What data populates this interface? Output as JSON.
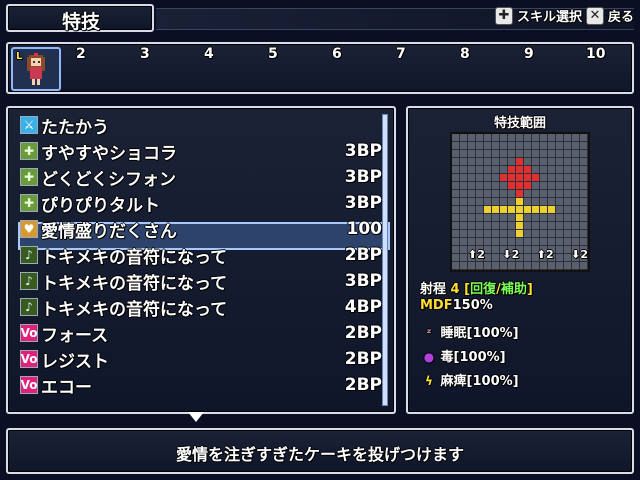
{
  "header": {
    "title": "特技",
    "hints": [
      {
        "icon": "✚",
        "label": "スキル選択"
      },
      {
        "icon": "✕",
        "label": "戻る"
      }
    ]
  },
  "party": {
    "slot1_label": "L",
    "slots": [
      "2",
      "3",
      "4",
      "5",
      "6",
      "7",
      "8",
      "9",
      "10"
    ]
  },
  "skills": [
    {
      "icon": "attack",
      "name": "たたかう",
      "cost": ""
    },
    {
      "icon": "plus",
      "name": "すやすやショコラ",
      "cost": "3BP"
    },
    {
      "icon": "plus",
      "name": "どくどくシフォン",
      "cost": "3BP"
    },
    {
      "icon": "plus",
      "name": "ぴりぴりタルト",
      "cost": "3BP"
    },
    {
      "icon": "heart",
      "name": "愛情盛りだくさん",
      "cost": "100"
    },
    {
      "icon": "note",
      "name": "トキメキの音符になって",
      "cost": "2BP"
    },
    {
      "icon": "note",
      "name": "トキメキの音符になって",
      "cost": "3BP"
    },
    {
      "icon": "note",
      "name": "トキメキの音符になって",
      "cost": "4BP"
    },
    {
      "icon": "vo",
      "name": "フォース",
      "cost": "2BP"
    },
    {
      "icon": "vo",
      "name": "レジスト",
      "cost": "2BP"
    },
    {
      "icon": "vo",
      "name": "エコー",
      "cost": "2BP"
    }
  ],
  "selected_index": 4,
  "range_panel": {
    "title": "特技範囲",
    "buffs": [
      "2",
      "2",
      "2",
      "2"
    ],
    "range_label": "射程",
    "range_value": "4",
    "range_type_open": "[",
    "range_type_a": "回復",
    "range_type_sep": "/",
    "range_type_b": "補助",
    "range_type_close": "]",
    "mdf_label": "MDF",
    "mdf_value": "150%",
    "effects": [
      {
        "icon": "sleep-icon",
        "label": "睡眠[100%]"
      },
      {
        "icon": "poison-icon",
        "label": "毒[100%]"
      },
      {
        "icon": "paralysis-icon",
        "label": "麻痺[100%]"
      }
    ]
  },
  "description": "愛情を注ぎすぎたケーキを投げつけます",
  "colors": {
    "accent": "#a8c8ff",
    "range_red": "#e03030",
    "range_yellow": "#f0d030"
  }
}
